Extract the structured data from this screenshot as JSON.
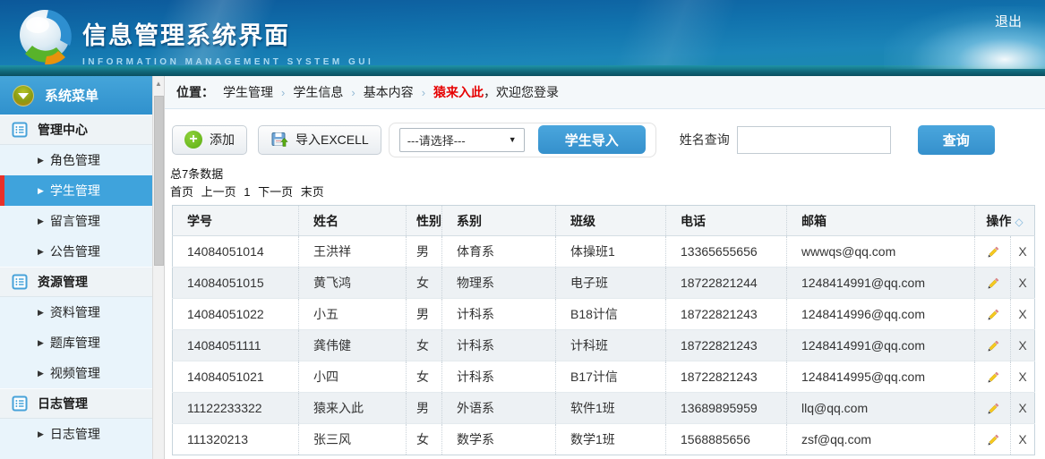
{
  "header": {
    "title": "信息管理系统界面",
    "subtitle": "INFORMATION MANAGEMENT SYSTEM GUI",
    "logout_label": "退出"
  },
  "sidebar": {
    "menu_title": "系统菜单",
    "active_item": "学生管理",
    "sections": [
      {
        "label": "管理中心",
        "items": [
          "角色管理",
          "学生管理",
          "留言管理",
          "公告管理"
        ]
      },
      {
        "label": "资源管理",
        "items": [
          "资料管理",
          "题库管理",
          "视频管理"
        ]
      },
      {
        "label": "日志管理",
        "items": [
          "日志管理"
        ]
      }
    ]
  },
  "breadcrumb": {
    "label": "位置：",
    "items": [
      "学生管理",
      "学生信息",
      "基本内容"
    ],
    "separator": "›",
    "current_user": "猿来入此",
    "welcome_suffix": "，欢迎您登录"
  },
  "toolbar": {
    "add_label": "添加",
    "import_label": "导入EXCELL",
    "select_value": "---请选择---",
    "student_import_label": "学生导入",
    "name_query_label": "姓名查询",
    "search_value": "",
    "search_label": "查询"
  },
  "summary": {
    "total_text": "总7条数据",
    "pagination": {
      "first": "首页",
      "prev": "上一页",
      "page": "1",
      "next": "下一页",
      "last": "末页"
    }
  },
  "table": {
    "headers": [
      "学号",
      "姓名",
      "性别",
      "系别",
      "班级",
      "电话",
      "邮箱",
      "操作"
    ],
    "sort_icon": "◇",
    "delete_label": "X",
    "rows": [
      [
        "14084051014",
        "王洪祥",
        "男",
        "体育系",
        "体操班1",
        "13365655656",
        "wwwqs@qq.com"
      ],
      [
        "14084051015",
        "黄飞鸿",
        "女",
        "物理系",
        "电子班",
        "18722821244",
        "1248414991@qq.com"
      ],
      [
        "14084051022",
        "小五",
        "男",
        "计科系",
        "B18计信",
        "18722821243",
        "1248414996@qq.com"
      ],
      [
        "14084051111",
        "龚伟健",
        "女",
        "计科系",
        "计科班",
        "18722821243",
        "1248414991@qq.com"
      ],
      [
        "14084051021",
        "小四",
        "女",
        "计科系",
        "B17计信",
        "18722821243",
        "1248414995@qq.com"
      ],
      [
        "11122233322",
        "猿来入此",
        "男",
        "外语系",
        "软件1班",
        "13689895959",
        "llq@qq.com"
      ],
      [
        "111320213",
        "张三风",
        "女",
        "数学系",
        "数学1班",
        "1568885656",
        "zsf@qq.com"
      ]
    ]
  },
  "icons": {
    "caret": "▶",
    "dropdown_arrow": "▼",
    "scroll_up": "▲"
  },
  "colors": {
    "accent_blue": "#3E9BD5",
    "sidebar_active_bg": "#3FA3DC",
    "sidebar_active_border": "#E8312A",
    "breadcrumb_highlight": "#E60000",
    "banner_teal": "#116A7C"
  }
}
